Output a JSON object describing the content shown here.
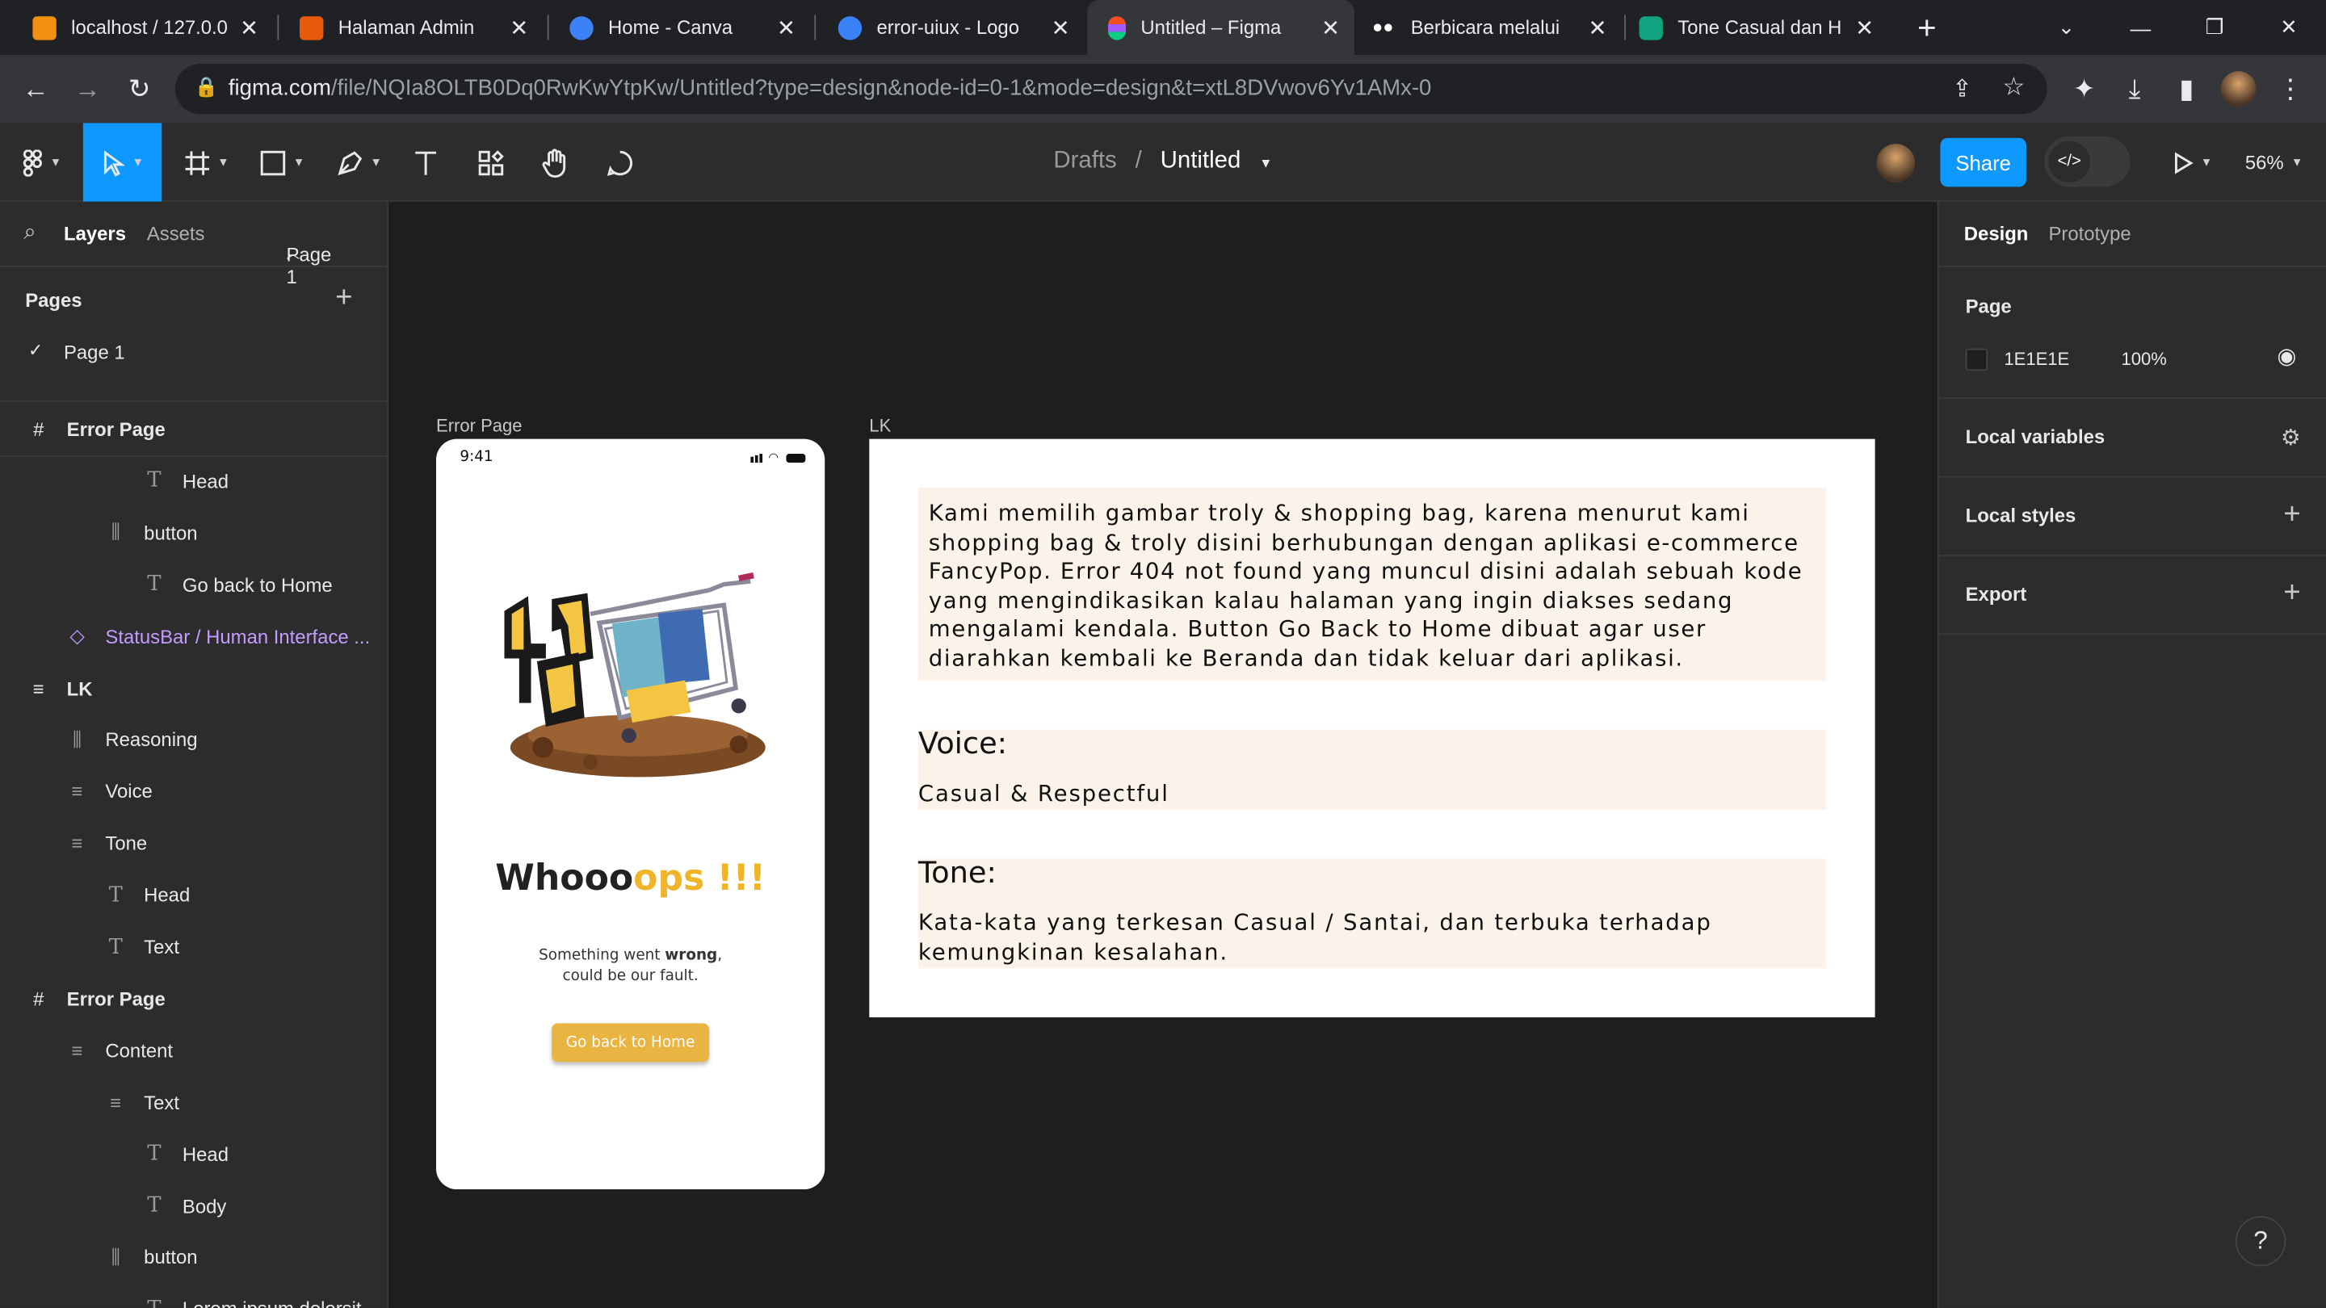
{
  "browser": {
    "tabs": [
      {
        "label": "localhost / 127.0.0",
        "color": "#f29111"
      },
      {
        "label": "Halaman Admin",
        "color": "#e8590c"
      },
      {
        "label": "Home - Canva",
        "color": "#3b82f6"
      },
      {
        "label": "error-uiux - Logo",
        "color": "#3b82f6"
      },
      {
        "label": "Untitled – Figma",
        "color": "#f24e1e"
      },
      {
        "label": "Berbicara melalui",
        "color": "#ffffff"
      },
      {
        "label": "Tone Casual dan H",
        "color": "#10a37f"
      }
    ],
    "new_tab": "+",
    "url_main": "figma.com",
    "url_rest": "/file/NQIa8OLTB0Dq0RwKwYtpKw/Untitled?type=design&node-id=0-1&mode=design&t=xtL8DVwov6Yv1AMx-0"
  },
  "toolbar": {
    "breadcrumb_parent": "Drafts",
    "breadcrumb_sep": "/",
    "file_name": "Untitled",
    "share_label": "Share",
    "zoom": "56%"
  },
  "left_panel": {
    "tab_layers": "Layers",
    "tab_assets": "Assets",
    "page_selector": "Page 1",
    "pages_heading": "Pages",
    "pages": [
      "Page 1"
    ],
    "layers": [
      {
        "label": "Error Page",
        "icon": "#",
        "indent": 0,
        "bold": true
      },
      {
        "label": "Head",
        "icon": "T",
        "indent": 3
      },
      {
        "label": "button",
        "icon": "bars",
        "indent": 2
      },
      {
        "label": "Go back to Home",
        "icon": "T",
        "indent": 3
      },
      {
        "label": "StatusBar / Human Interface ...",
        "icon": "diamond",
        "indent": 1,
        "component": true
      },
      {
        "label": "LK",
        "icon": "lines",
        "indent": 0,
        "bold": true
      },
      {
        "label": "Reasoning",
        "icon": "bars",
        "indent": 1
      },
      {
        "label": "Voice",
        "icon": "lines",
        "indent": 1
      },
      {
        "label": "Tone",
        "icon": "lines",
        "indent": 1
      },
      {
        "label": "Head",
        "icon": "T",
        "indent": 2
      },
      {
        "label": "Text",
        "icon": "T",
        "indent": 2
      },
      {
        "label": "Error Page",
        "icon": "#",
        "indent": 0,
        "bold": true
      },
      {
        "label": "Content",
        "icon": "lines",
        "indent": 1
      },
      {
        "label": "Text",
        "icon": "lines",
        "indent": 2
      },
      {
        "label": "Head",
        "icon": "T",
        "indent": 3
      },
      {
        "label": "Body",
        "icon": "T",
        "indent": 3
      },
      {
        "label": "button",
        "icon": "bars",
        "indent": 2
      },
      {
        "label": "Lorem ipsum dolorsit...",
        "icon": "T",
        "indent": 3
      }
    ]
  },
  "canvas": {
    "frame1_label": "Error Page",
    "frame2_label": "LK",
    "phone": {
      "time": "9:41",
      "headline_dark": "Whooo",
      "headline_accent": "ops !!!",
      "body_line1_a": "Something went ",
      "body_line1_b": "wrong",
      "body_line1_c": ",",
      "body_line2": "could be our fault.",
      "button_label": "Go back to Home",
      "accent_color": "#f0b429"
    },
    "lk": {
      "reasoning_lines": [
        "Kami memilih gambar troly & shopping bag, karena menurut kami",
        "shopping bag & troly disini berhubungan dengan aplikasi e-commerce",
        "FancyPop. Error 404 not found yang muncul disini adalah sebuah kode",
        "yang mengindikasikan kalau halaman yang ingin diakses sedang",
        "mengalami kendala. Button Go Back to Home dibuat agar user",
        "diarahkan kembali ke Beranda dan tidak keluar dari aplikasi."
      ],
      "voice_head": "Voice:",
      "voice_text": "Casual & Respectful",
      "tone_head": "Tone:",
      "tone_lines": [
        "Kata-kata yang terkesan Casual / Santai, dan terbuka terhadap",
        "kemungkinan kesalahan."
      ]
    }
  },
  "right_panel": {
    "tab_design": "Design",
    "tab_prototype": "Prototype",
    "page_heading": "Page",
    "page_color": "1E1E1E",
    "page_opacity": "100%",
    "local_variables": "Local variables",
    "local_styles": "Local styles",
    "export": "Export",
    "help": "?"
  }
}
